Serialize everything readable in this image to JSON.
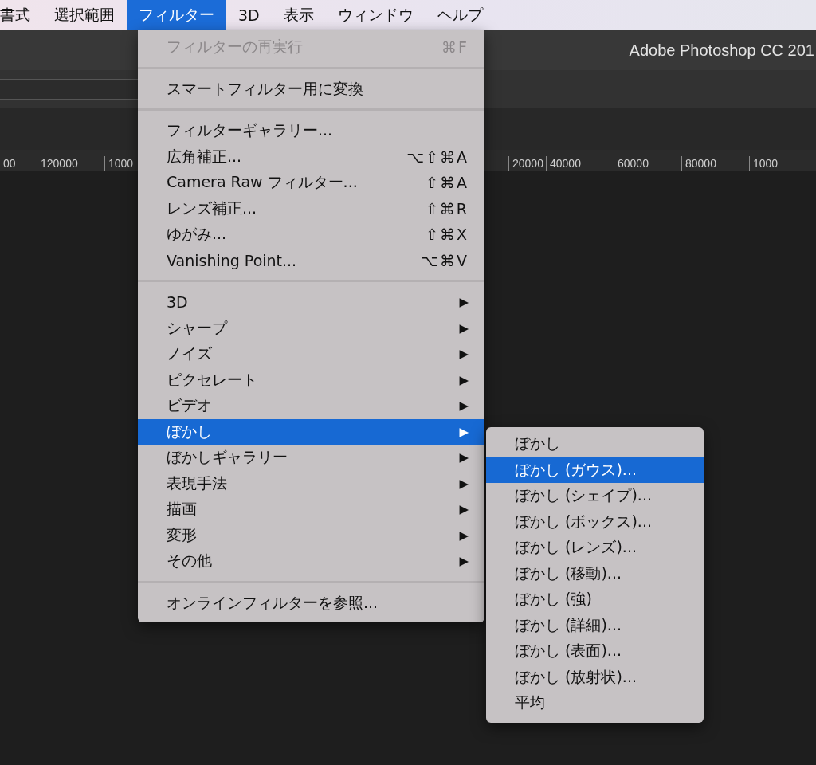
{
  "menubar": [
    {
      "label": "書式",
      "selected": false
    },
    {
      "label": "選択範囲",
      "selected": false
    },
    {
      "label": "フィルター",
      "selected": true
    },
    {
      "label": "3D",
      "selected": false
    },
    {
      "label": "表示",
      "selected": false
    },
    {
      "label": "ウィンドウ",
      "selected": false
    },
    {
      "label": "ヘルプ",
      "selected": false
    }
  ],
  "window": {
    "title": "Adobe Photoshop CC 201"
  },
  "ruler": {
    "left_labels": [
      "00",
      "120000",
      "1000"
    ],
    "right_labels": [
      "20000",
      "40000",
      "60000",
      "80000",
      "1000"
    ]
  },
  "filter_menu": {
    "items": [
      {
        "kind": "item",
        "label": "フィルターの再実行",
        "shortcut": "⌘F",
        "disabled": true,
        "selected": false
      },
      {
        "kind": "separator"
      },
      {
        "kind": "item",
        "label": "スマートフィルター用に変換",
        "disabled": false,
        "selected": false
      },
      {
        "kind": "separator"
      },
      {
        "kind": "item",
        "label": "フィルターギャラリー...",
        "disabled": false,
        "selected": false
      },
      {
        "kind": "item",
        "label": "広角補正...",
        "shortcut": "⌥⇧⌘A",
        "disabled": false,
        "selected": false
      },
      {
        "kind": "item",
        "label": "Camera Raw フィルター...",
        "shortcut": "⇧⌘A",
        "disabled": false,
        "selected": false
      },
      {
        "kind": "item",
        "label": "レンズ補正...",
        "shortcut": "⇧⌘R",
        "disabled": false,
        "selected": false
      },
      {
        "kind": "item",
        "label": "ゆがみ...",
        "shortcut": "⇧⌘X",
        "disabled": false,
        "selected": false
      },
      {
        "kind": "item",
        "label": "Vanishing Point...",
        "shortcut": "⌥⌘V",
        "disabled": false,
        "selected": false
      },
      {
        "kind": "separator"
      },
      {
        "kind": "submenu",
        "label": "3D",
        "arrow": "▶",
        "disabled": false,
        "selected": false
      },
      {
        "kind": "submenu",
        "label": "シャープ",
        "arrow": "▶",
        "disabled": false,
        "selected": false
      },
      {
        "kind": "submenu",
        "label": "ノイズ",
        "arrow": "▶",
        "disabled": false,
        "selected": false
      },
      {
        "kind": "submenu",
        "label": "ピクセレート",
        "arrow": "▶",
        "disabled": false,
        "selected": false
      },
      {
        "kind": "submenu",
        "label": "ビデオ",
        "arrow": "▶",
        "disabled": false,
        "selected": false
      },
      {
        "kind": "submenu",
        "label": "ぼかし",
        "arrow": "▶",
        "disabled": false,
        "selected": true
      },
      {
        "kind": "submenu",
        "label": "ぼかしギャラリー",
        "arrow": "▶",
        "disabled": false,
        "selected": false
      },
      {
        "kind": "submenu",
        "label": "表現手法",
        "arrow": "▶",
        "disabled": false,
        "selected": false
      },
      {
        "kind": "submenu",
        "label": "描画",
        "arrow": "▶",
        "disabled": false,
        "selected": false
      },
      {
        "kind": "submenu",
        "label": "変形",
        "arrow": "▶",
        "disabled": false,
        "selected": false
      },
      {
        "kind": "submenu",
        "label": "その他",
        "arrow": "▶",
        "disabled": false,
        "selected": false
      },
      {
        "kind": "separator"
      },
      {
        "kind": "item",
        "label": "オンラインフィルターを参照...",
        "disabled": false,
        "selected": false
      }
    ]
  },
  "blur_submenu": {
    "items": [
      {
        "label": "ぼかし",
        "selected": false
      },
      {
        "label": "ぼかし (ガウス)...",
        "selected": true
      },
      {
        "label": "ぼかし (シェイプ)...",
        "selected": false
      },
      {
        "label": "ぼかし (ボックス)...",
        "selected": false
      },
      {
        "label": "ぼかし (レンズ)...",
        "selected": false
      },
      {
        "label": "ぼかし (移動)...",
        "selected": false
      },
      {
        "label": "ぼかし (強)",
        "selected": false
      },
      {
        "label": "ぼかし (詳細)...",
        "selected": false
      },
      {
        "label": "ぼかし (表面)...",
        "selected": false
      },
      {
        "label": "ぼかし (放射状)...",
        "selected": false
      },
      {
        "label": "平均",
        "selected": false
      }
    ]
  }
}
